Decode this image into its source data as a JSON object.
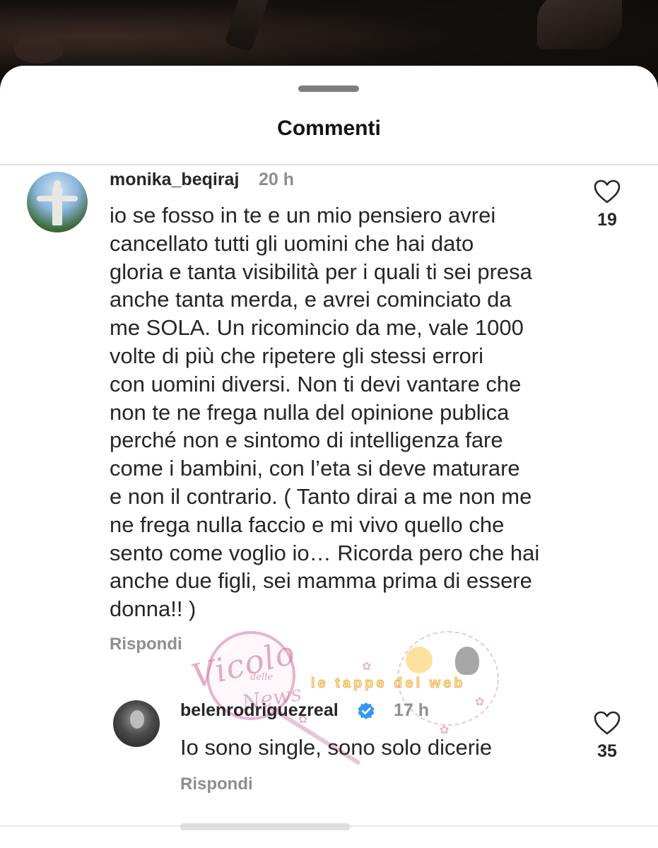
{
  "sheet": {
    "title": "Commenti"
  },
  "comments": [
    {
      "username": "monika_beqiraj",
      "time": "20 h",
      "text": "io se fosso in te e un mio pensiero avrei\ncancellato tutti gli uomini che hai dato\ngloria e tanta visibilità per i quali ti sei presa\nanche tanta merda, e avrei cominciato da\nme SOLA. Un ricomincio da me, vale 1000\nvolte di più che ripetere gli stessi errori\ncon uomini diversi. Non ti devi vantare che\nnon te ne frega nulla del opinione publica\nperché non e sintomo di intelligenza fare\ncome i bambini, con l’eta si deve maturare\ne non il contrario. ( Tanto dirai a me non me\nne frega nulla faccio e mi vivo quello che\nsento come voglio io… Ricorda pero che hai\nanche due figli, sei mamma prima di essere\ndonna!! )",
      "reply_label": "Rispondi",
      "likes": "19"
    },
    {
      "username": "belenrodriguezreal",
      "verified": true,
      "time": "17 h",
      "text": "Io sono single, sono solo dicerie",
      "reply_label": "Rispondi",
      "likes": "35"
    }
  ],
  "watermark": {
    "script": "Vicolo",
    "small": "delle",
    "script2": "News",
    "ribbon": "le tappe del web"
  },
  "icons": {
    "heart": "heart-icon",
    "verified": "verified-badge-icon",
    "drag": "drag-handle"
  },
  "colors": {
    "text": "#262626",
    "muted": "#8e8e8e",
    "verified": "#3897f0",
    "sheet": "#ffffff"
  }
}
